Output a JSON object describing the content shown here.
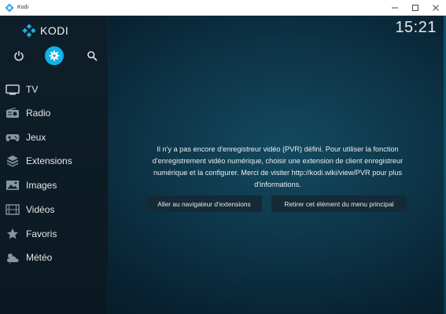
{
  "window": {
    "title": "Kodi",
    "icon": "kodi-icon",
    "controls": [
      "minimize-icon",
      "maximize-icon",
      "close-icon"
    ]
  },
  "app": {
    "brand": "KODI",
    "clock": "15:21",
    "top_icons": [
      "power-icon",
      "settings-icon",
      "search-icon"
    ],
    "active_top_icon": "settings-icon",
    "accent_color": "#12b2e7",
    "menu": [
      {
        "label": "TV",
        "icon": "tv-icon"
      },
      {
        "label": "Radio",
        "icon": "radio-icon"
      },
      {
        "label": "Jeux",
        "icon": "gamepad-icon"
      },
      {
        "label": "Extensions",
        "icon": "box-icon"
      },
      {
        "label": "Images",
        "icon": "image-icon"
      },
      {
        "label": "Vidéos",
        "icon": "film-icon"
      },
      {
        "label": "Favoris",
        "icon": "star-icon"
      },
      {
        "label": "Météo",
        "icon": "weather-icon"
      }
    ],
    "message_lines": [
      "Il n'y a pas encore d'enregistreur vidéo (PVR) défini. Pour utiliser la fonction",
      "d'enregistrement vidéo numérique, choisir une extension de client enregistreur",
      "numérique et la configurer. Merci de visiter http://kodi.wiki/view/PVR pour plus",
      "d'informations."
    ],
    "buttons": {
      "browse": "Aller au navigateur d'extensions",
      "remove": "Retirer cet élément du menu principal"
    }
  }
}
